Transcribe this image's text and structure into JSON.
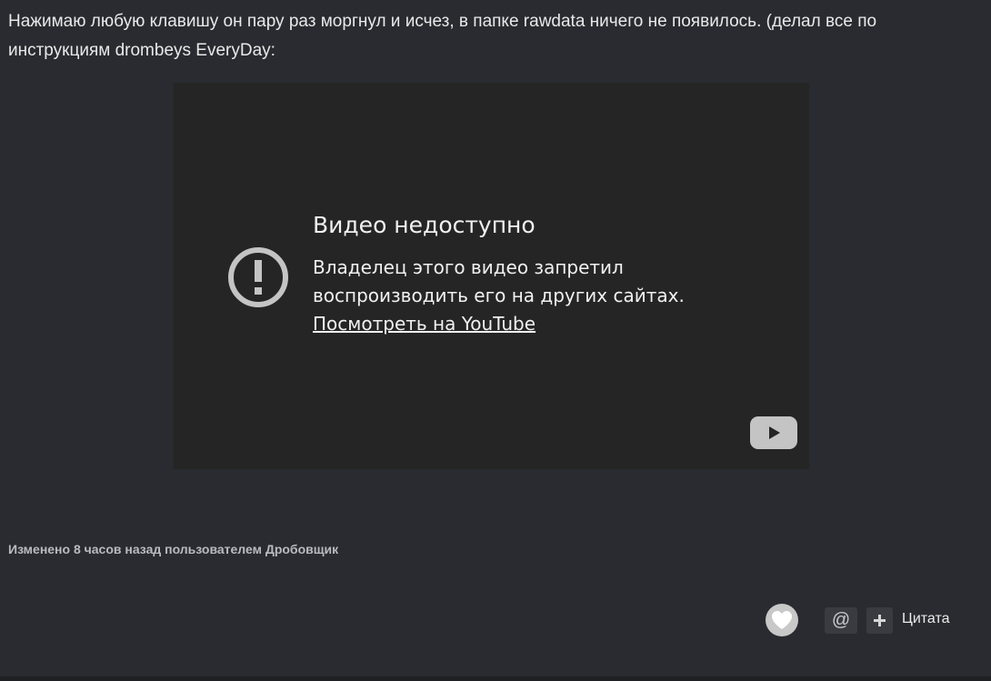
{
  "post": {
    "text": "Нажимаю любую клавишу он пару раз моргнул и исчез, в папке rawdata ничего не появилось. (делал все по инструкциям drombeys EveryDay:"
  },
  "video": {
    "title": "Видео недоступно",
    "description": "Владелец этого видео запретил воспроизводить его на других сайтах.",
    "link_text": "Посмотреть на YouTube",
    "warning_icon": "exclamation-circle-icon",
    "logo_icon": "youtube-logo-icon"
  },
  "footer": {
    "edited_note": "Изменено 8 часов назад пользователем Дробовщик",
    "mention_label": "@",
    "quote_label": "Цитата",
    "like_icon": "heart-icon",
    "plus_icon": "plus-icon"
  },
  "colors": {
    "background": "#2a2b30",
    "video_background": "#252525",
    "button_background": "#3a3b41",
    "like_circle": "#c8c8c8",
    "icon_gray": "#c4c4c4"
  }
}
